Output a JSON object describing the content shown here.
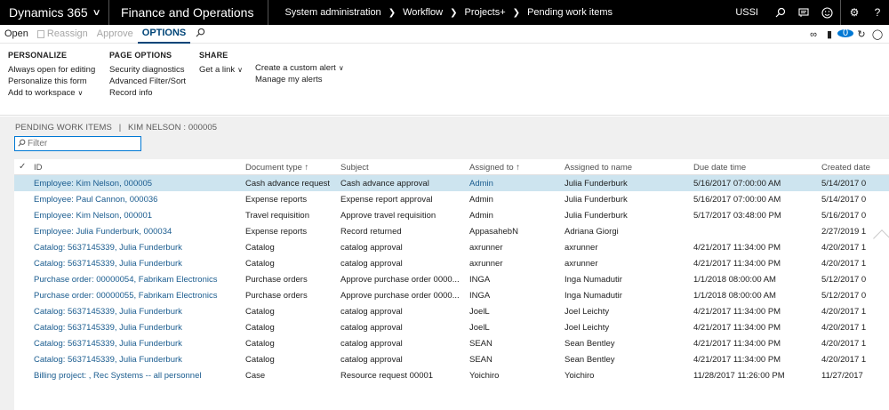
{
  "topbar": {
    "app_name": "Dynamics 365",
    "module": "Finance and Operations",
    "breadcrumbs": [
      "System administration",
      "Workflow",
      "Projects+",
      "Pending work items"
    ],
    "company": "USSI"
  },
  "actionbar": {
    "open": "Open",
    "reassign": "Reassign",
    "approve": "Approve",
    "options": "OPTIONS",
    "notifications_count": "0"
  },
  "ribbon": {
    "personalize": {
      "title": "PERSONALIZE",
      "items": [
        "Always open for editing",
        "Personalize this form",
        "Add to workspace"
      ]
    },
    "page_options": {
      "title": "PAGE OPTIONS",
      "items": [
        "Security diagnostics",
        "Advanced Filter/Sort",
        "Record info"
      ]
    },
    "share": {
      "title": "SHARE",
      "get_link": "Get a link",
      "create_alert": "Create a custom alert",
      "manage_alerts": "Manage my alerts"
    }
  },
  "page": {
    "header": "PENDING WORK ITEMS",
    "separator": "|",
    "subheader": "KIM NELSON : 000005",
    "filter_placeholder": "Filter"
  },
  "grid": {
    "columns": {
      "id": "ID",
      "doc_type": "Document type",
      "subject": "Subject",
      "assigned_to": "Assigned to",
      "assigned_name": "Assigned to name",
      "due": "Due date time",
      "created": "Created date"
    },
    "sort_arrow": "↑",
    "rows": [
      {
        "id": "Employee: Kim Nelson, 000005",
        "doc_type": "Cash advance request",
        "subject": "Cash advance approval",
        "assigned_to": "Admin",
        "assigned_name": "Julia Funderburk",
        "due": "5/16/2017 07:00:00 AM",
        "created": "5/14/2017 0"
      },
      {
        "id": "Employee: Paul Cannon, 000036",
        "doc_type": "Expense reports",
        "subject": "Expense report approval",
        "assigned_to": "Admin",
        "assigned_name": "Julia Funderburk",
        "due": "5/16/2017 07:00:00 AM",
        "created": "5/14/2017 0"
      },
      {
        "id": "Employee: Kim Nelson, 000001",
        "doc_type": "Travel requisition",
        "subject": "Approve travel requisition",
        "assigned_to": "Admin",
        "assigned_name": "Julia Funderburk",
        "due": "5/17/2017 03:48:00 PM",
        "created": "5/16/2017 0"
      },
      {
        "id": "Employee: Julia Funderburk, 000034",
        "doc_type": "Expense reports",
        "subject": "Record returned",
        "assigned_to": "AppasahebN",
        "assigned_name": "Adriana Giorgi",
        "due": "",
        "created": "2/27/2019 1"
      },
      {
        "id": "Catalog: 5637145339, Julia Funderburk",
        "doc_type": "Catalog",
        "subject": "catalog approval",
        "assigned_to": "axrunner",
        "assigned_name": "axrunner",
        "due": "4/21/2017 11:34:00 PM",
        "created": "4/20/2017 1"
      },
      {
        "id": "Catalog: 5637145339, Julia Funderburk",
        "doc_type": "Catalog",
        "subject": "catalog approval",
        "assigned_to": "axrunner",
        "assigned_name": "axrunner",
        "due": "4/21/2017 11:34:00 PM",
        "created": "4/20/2017 1"
      },
      {
        "id": "Purchase order: 00000054, Fabrikam Electronics",
        "doc_type": "Purchase orders",
        "subject": "Approve purchase order 0000...",
        "assigned_to": "INGA",
        "assigned_name": "Inga Numadutir",
        "due": "1/1/2018 08:00:00 AM",
        "created": "5/12/2017 0"
      },
      {
        "id": "Purchase order: 00000055, Fabrikam Electronics",
        "doc_type": "Purchase orders",
        "subject": "Approve purchase order 0000...",
        "assigned_to": "INGA",
        "assigned_name": "Inga Numadutir",
        "due": "1/1/2018 08:00:00 AM",
        "created": "5/12/2017 0"
      },
      {
        "id": "Catalog: 5637145339, Julia Funderburk",
        "doc_type": "Catalog",
        "subject": "catalog approval",
        "assigned_to": "JoelL",
        "assigned_name": "Joel Leichty",
        "due": "4/21/2017 11:34:00 PM",
        "created": "4/20/2017 1"
      },
      {
        "id": "Catalog: 5637145339, Julia Funderburk",
        "doc_type": "Catalog",
        "subject": "catalog approval",
        "assigned_to": "JoelL",
        "assigned_name": "Joel Leichty",
        "due": "4/21/2017 11:34:00 PM",
        "created": "4/20/2017 1"
      },
      {
        "id": "Catalog: 5637145339, Julia Funderburk",
        "doc_type": "Catalog",
        "subject": "catalog approval",
        "assigned_to": "SEAN",
        "assigned_name": "Sean Bentley",
        "due": "4/21/2017 11:34:00 PM",
        "created": "4/20/2017 1"
      },
      {
        "id": "Catalog: 5637145339, Julia Funderburk",
        "doc_type": "Catalog",
        "subject": "catalog approval",
        "assigned_to": "SEAN",
        "assigned_name": "Sean Bentley",
        "due": "4/21/2017 11:34:00 PM",
        "created": "4/20/2017 1"
      },
      {
        "id": "Billing project: , Rec Systems -- all personnel",
        "doc_type": "Case",
        "subject": "Resource request 00001",
        "assigned_to": "Yoichiro",
        "assigned_name": "Yoichiro",
        "due": "11/28/2017 11:26:00 PM",
        "created": "11/27/2017"
      }
    ]
  },
  "colors": {
    "topbar_bg": "#000000",
    "accent": "#0078d4",
    "link": "#1a5c8f",
    "selected_row": "#cde4ef"
  }
}
